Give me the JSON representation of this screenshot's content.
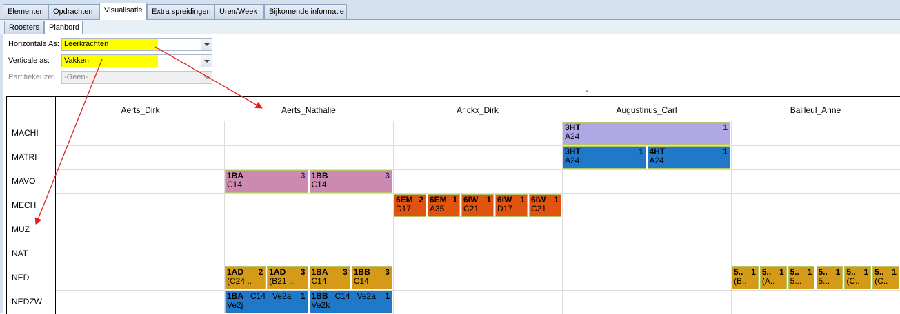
{
  "tabs": [
    {
      "label": "Elementen"
    },
    {
      "label": "Opdrachten"
    },
    {
      "label": "Visualisatie"
    },
    {
      "label": "Extra spreidingen"
    },
    {
      "label": "Uren/Week"
    },
    {
      "label": "Bijkomende informatie"
    }
  ],
  "subtabs": [
    {
      "label": "Roosters"
    },
    {
      "label": "Planbord"
    }
  ],
  "form": {
    "horizontal": {
      "label": "Horizontale As:",
      "value": "Leerkrachten"
    },
    "vertical": {
      "label": "Verticale as:",
      "value": "Vakken"
    },
    "partition": {
      "label": "Partitiekeuze:",
      "value": "-Geen-"
    }
  },
  "grid": {
    "columns": [
      "Aerts_Dirk",
      "Aerts_Nathalie",
      "Arickx_Dirk",
      "Augustinus_Carl",
      "Bailleul_Anne"
    ],
    "rows": [
      "MACHI",
      "MATRI",
      "MAVO",
      "MECH",
      "MUZ",
      "NAT",
      "NED",
      "NEDZW"
    ]
  },
  "cards": [
    {
      "row": "MACHI",
      "teacher": "Augustinus_Carl",
      "cls": "3HT",
      "count": "1",
      "room": "A24",
      "color": "#b0a8e4"
    },
    {
      "row": "MATRI",
      "teacher": "Augustinus_Carl",
      "cls": "3HT",
      "count": "1",
      "room": "A24",
      "color": "#1f78c8"
    },
    {
      "row": "MATRI",
      "teacher": "Augustinus_Carl",
      "cls": "4HT",
      "count": "1",
      "room": "A24",
      "color": "#1f78c8"
    },
    {
      "row": "MAVO",
      "teacher": "Aerts_Nathalie",
      "cls": "1BA",
      "count": "3",
      "room": "C14",
      "color": "#cc8ab0"
    },
    {
      "row": "MAVO",
      "teacher": "Aerts_Nathalie",
      "cls": "1BB",
      "count": "3",
      "room": "C14",
      "color": "#cc8ab0"
    },
    {
      "row": "MECH",
      "teacher": "Arickx_Dirk",
      "cls": "6EM",
      "count": "2",
      "room": "D17",
      "color": "#e1540f"
    },
    {
      "row": "MECH",
      "teacher": "Arickx_Dirk",
      "cls": "6EM",
      "count": "1",
      "room": "A35",
      "color": "#e1540f"
    },
    {
      "row": "MECH",
      "teacher": "Arickx_Dirk",
      "cls": "6IW",
      "count": "1",
      "room": "C21",
      "color": "#e1540f"
    },
    {
      "row": "MECH",
      "teacher": "Arickx_Dirk",
      "cls": "6IW",
      "count": "1",
      "room": "D17",
      "color": "#e1540f"
    },
    {
      "row": "MECH",
      "teacher": "Arickx_Dirk",
      "cls": "6IW",
      "count": "1",
      "room": "C21",
      "color": "#e1540f"
    },
    {
      "row": "NED",
      "teacher": "Aerts_Nathalie",
      "cls": "1AD",
      "count": "2",
      "room": "(C24 ..",
      "color": "#d49a18"
    },
    {
      "row": "NED",
      "teacher": "Aerts_Nathalie",
      "cls": "1AD",
      "count": "3",
      "room": "(B21 ..",
      "color": "#d49a18"
    },
    {
      "row": "NED",
      "teacher": "Aerts_Nathalie",
      "cls": "1BA",
      "count": "3",
      "room": "C14",
      "color": "#d49a18"
    },
    {
      "row": "NED",
      "teacher": "Aerts_Nathalie",
      "cls": "1BB",
      "count": "3",
      "room": "C14",
      "color": "#d49a18"
    },
    {
      "row": "NED",
      "teacher": "Bailleul_Anne",
      "cls": "5..",
      "count": "1",
      "room": "(B..",
      "color": "#d49a18"
    },
    {
      "row": "NED",
      "teacher": "Bailleul_Anne",
      "cls": "5..",
      "count": "1",
      "room": "(A..",
      "color": "#d49a18"
    },
    {
      "row": "NED",
      "teacher": "Bailleul_Anne",
      "cls": "5..",
      "count": "1",
      "room": "5...",
      "color": "#d49a18"
    },
    {
      "row": "NED",
      "teacher": "Bailleul_Anne",
      "cls": "5..",
      "count": "1",
      "room": "5...",
      "color": "#d49a18"
    },
    {
      "row": "NED",
      "teacher": "Bailleul_Anne",
      "cls": "5..",
      "count": "1",
      "room": "(C..",
      "color": "#d49a18"
    },
    {
      "row": "NED",
      "teacher": "Bailleul_Anne",
      "cls": "5..",
      "count": "1",
      "room": "(C..",
      "color": "#d49a18"
    },
    {
      "row": "NEDZW",
      "teacher": "Aerts_Nathalie",
      "cls": "1BA",
      "room_mid": "C14",
      "extra": "Ve2a",
      "count": "1",
      "room": "Ve2j",
      "color": "#1f78c8"
    },
    {
      "row": "NEDZW",
      "teacher": "Aerts_Nathalie",
      "cls": "1BB",
      "room_mid": "C14",
      "extra": "Ve2a",
      "count": "1",
      "room": "Ve2k",
      "color": "#1f78c8"
    }
  ],
  "annotation_color": "#e02020"
}
